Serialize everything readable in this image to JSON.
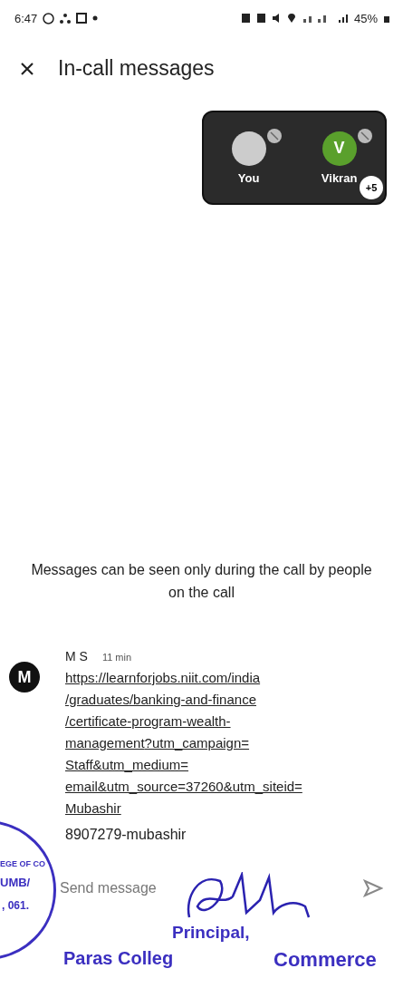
{
  "status_bar": {
    "time": "6:47",
    "battery": "45%"
  },
  "header": {
    "title": "In-call messages"
  },
  "participants": [
    {
      "name": "You",
      "kind": "photo",
      "muted": true
    },
    {
      "name": "Vikran",
      "kind": "letter",
      "initial": "V",
      "muted": true
    }
  ],
  "more_count": "+5",
  "notice": "Messages can be seen only during the call by people on the call",
  "messages": [
    {
      "sender": "M S",
      "avatar": "M",
      "time": "11 min",
      "link": "https://learnforjobs.niit.com/india/graduates/banking-and-finance/certificate-program-wealth-management?utm_campaign=Staff&utm_medium=email&utm_source=37260&utm_siteid=Mubashir",
      "text": "8907279-mubashir"
    }
  ],
  "composer": {
    "placeholder": "Send message"
  },
  "stamp": {
    "ring_top": "EGE OF CO",
    "ring_left": "UMB/",
    "ring_bottom": ", 061.",
    "title": "Principal,",
    "college_left": "Paras Colleg",
    "college_right": "Commerce"
  }
}
